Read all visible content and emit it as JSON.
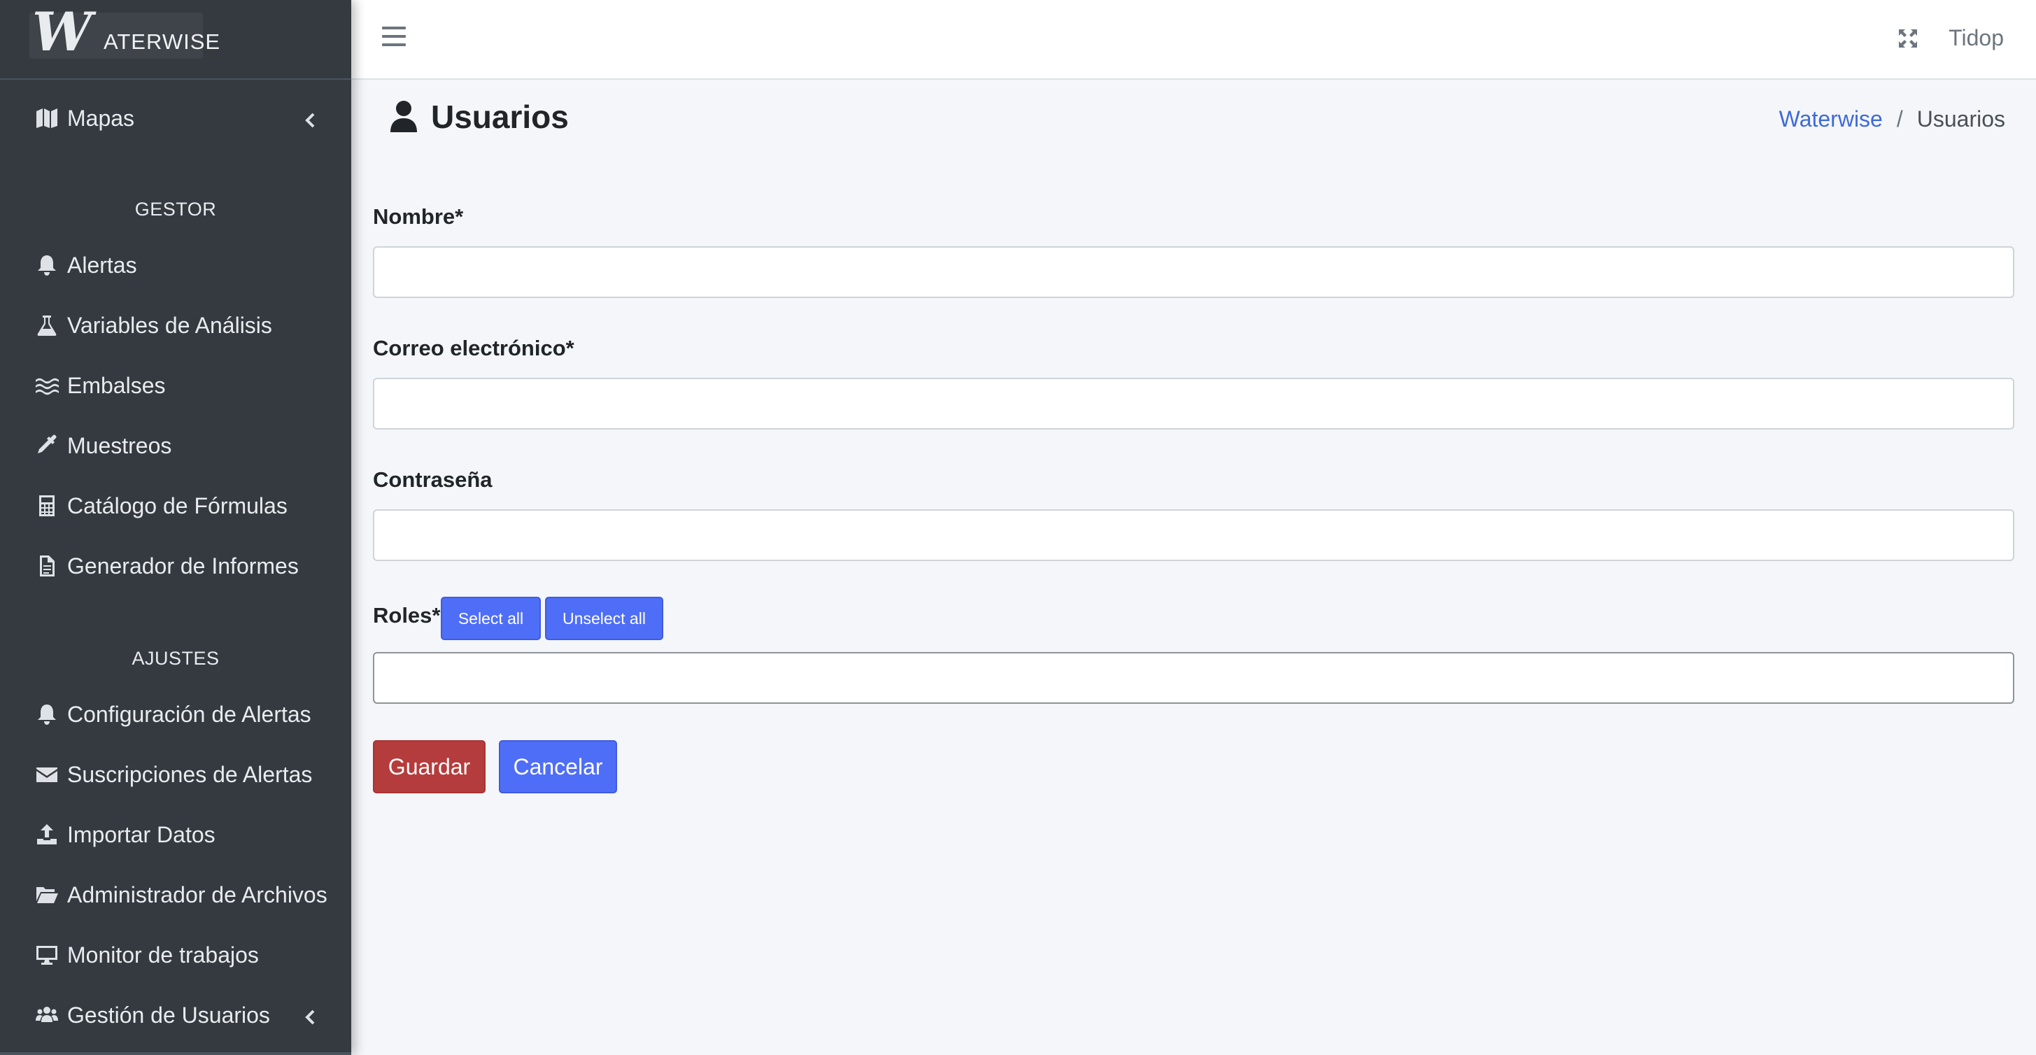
{
  "brand": {
    "logo_letter": "W",
    "logo_rest": "ATERWISE"
  },
  "navbar": {
    "user": "Tidop"
  },
  "sidebar": {
    "top_item": {
      "label": "Mapas",
      "icon": "map-icon"
    },
    "section_gestor": "GESTOR",
    "gestor_items": [
      {
        "label": "Alertas",
        "icon": "bell-icon"
      },
      {
        "label": "Variables de Análisis",
        "icon": "flask-icon"
      },
      {
        "label": "Embalses",
        "icon": "water-icon"
      },
      {
        "label": "Muestreos",
        "icon": "eyedropper-icon"
      },
      {
        "label": "Catálogo de Fórmulas",
        "icon": "calculator-icon"
      },
      {
        "label": "Generador de Informes",
        "icon": "file-text-icon"
      }
    ],
    "section_ajustes": "AJUSTES",
    "ajustes_items": [
      {
        "label": "Configuración de Alertas",
        "icon": "bell-icon"
      },
      {
        "label": "Suscripciones de Alertas",
        "icon": "envelope-icon"
      },
      {
        "label": "Importar Datos",
        "icon": "upload-icon"
      },
      {
        "label": "Administrador de Archivos",
        "icon": "folder-open-icon"
      },
      {
        "label": "Monitor de trabajos",
        "icon": "desktop-icon"
      },
      {
        "label": "Gestión de Usuarios",
        "icon": "users-icon"
      }
    ]
  },
  "page": {
    "title": "Usuarios",
    "breadcrumb": {
      "home": "Waterwise",
      "separator": "/",
      "current": "Usuarios"
    }
  },
  "form": {
    "name_label": "Nombre*",
    "name_value": "",
    "email_label": "Correo electrónico*",
    "email_value": "",
    "password_label": "Contraseña",
    "password_value": "",
    "roles_label": "Roles*",
    "select_all": "Select all",
    "unselect_all": "Unselect all",
    "roles_value": "",
    "save": "Guardar",
    "cancel": "Cancelar"
  },
  "colors": {
    "sidebar_bg": "#343a40",
    "primary": "#4f6ef7",
    "danger": "#b53c3c",
    "link": "#3f6ad8",
    "content_bg": "#f4f6f9"
  }
}
